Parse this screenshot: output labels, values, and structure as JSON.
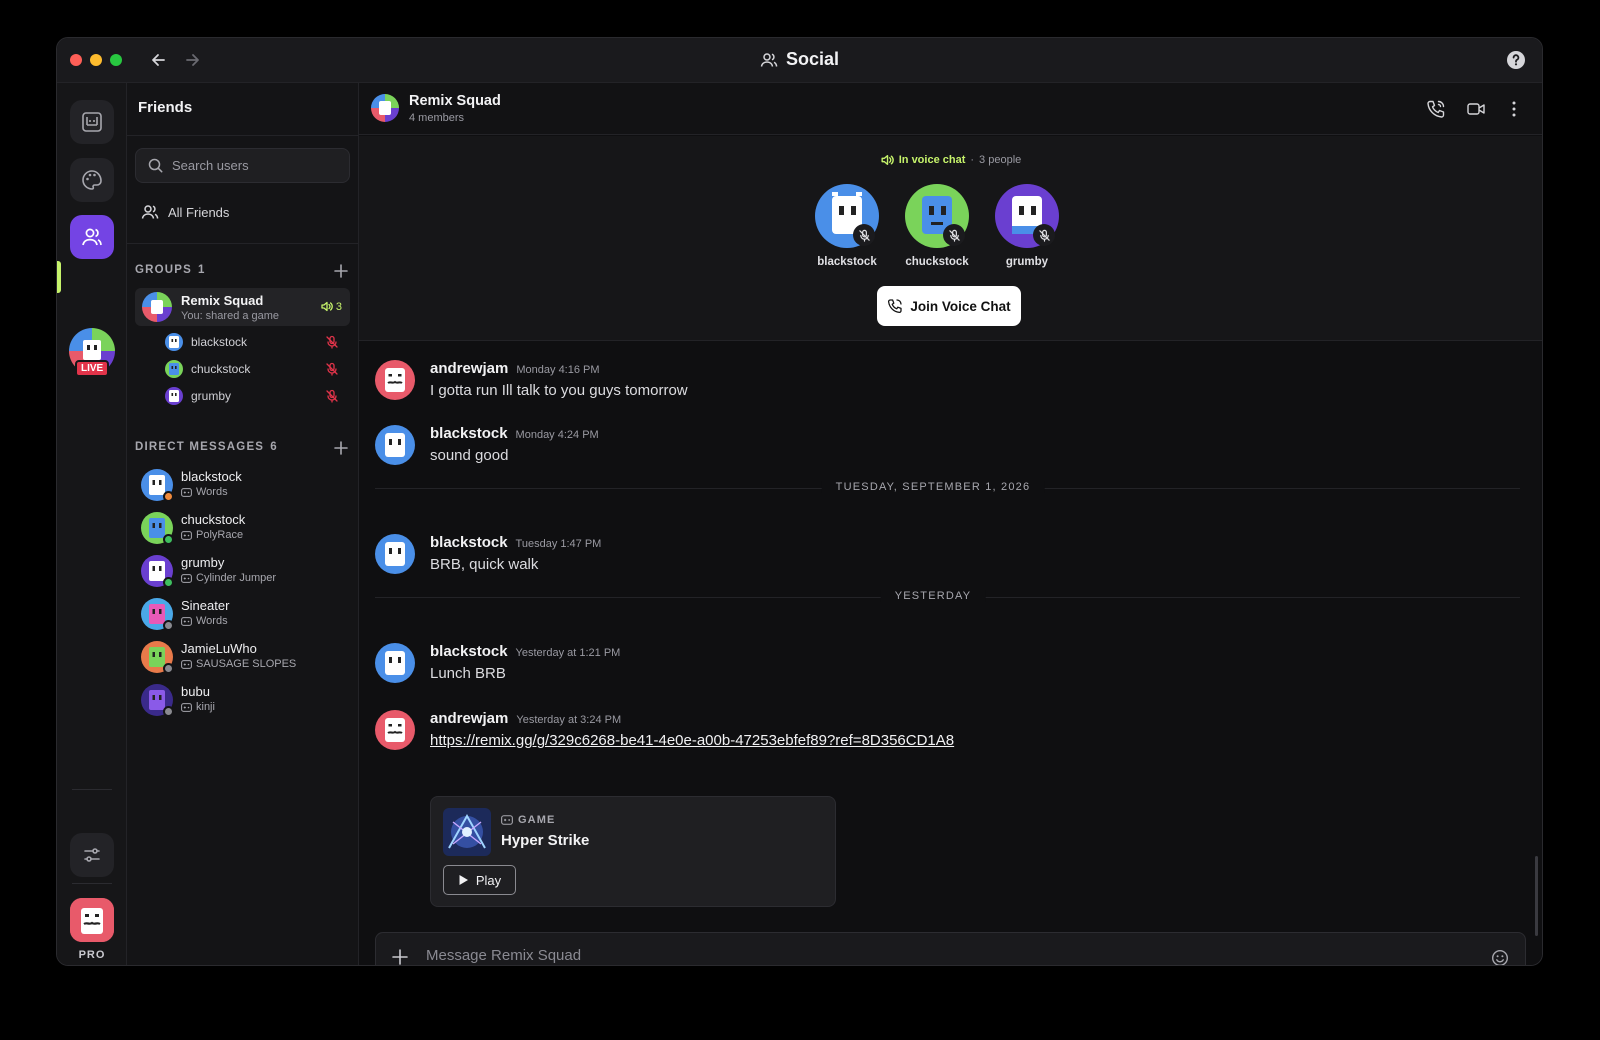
{
  "window": {
    "title": "Social"
  },
  "rail": {
    "live_label": "LIVE",
    "pro_label": "PRO"
  },
  "sidebar": {
    "title": "Friends",
    "search_placeholder": "Search users",
    "all_friends": "All Friends",
    "groups_label": "GROUPS",
    "groups_count": "1",
    "group": {
      "name": "Remix Squad",
      "subtitle": "You: shared a game",
      "voice_count": "3"
    },
    "group_members": [
      "blackstock",
      "chuckstock",
      "grumby"
    ],
    "dm_label": "DIRECT MESSAGES",
    "dm_count": "6",
    "dms": [
      {
        "name": "blackstock",
        "game": "Words",
        "status_color": "#f08a3c"
      },
      {
        "name": "chuckstock",
        "game": "PolyRace",
        "status_color": "#3fbf5f"
      },
      {
        "name": "grumby",
        "game": "Cylinder Jumper",
        "status_color": "#3fbf5f"
      },
      {
        "name": "Sineater",
        "game": "Words",
        "status_color": "#8a8a90"
      },
      {
        "name": "JamieLuWho",
        "game": "SAUSAGE SLOPES",
        "status_color": "#8a8a90"
      },
      {
        "name": "bubu",
        "game": "kinji",
        "status_color": "#8a8a90"
      }
    ]
  },
  "chat": {
    "name": "Remix Squad",
    "members_label": "4 members",
    "voice": {
      "status_label": "In voice chat",
      "people_label": "3 people",
      "users": [
        "blackstock",
        "chuckstock",
        "grumby"
      ],
      "join_label": "Join Voice Chat"
    },
    "messages": [
      {
        "author": "andrewjam",
        "time": "Monday 4:16 PM",
        "text": "I gotta run Ill talk to you guys tomorrow"
      },
      {
        "author": "blackstock",
        "time": "Monday 4:24 PM",
        "text": "sound good"
      },
      {
        "author": "blackstock",
        "time": "Tuesday 1:47 PM",
        "text": "BRB, quick walk"
      },
      {
        "author": "blackstock",
        "time": "Yesterday at 1:21 PM",
        "text": "Lunch BRB"
      },
      {
        "author": "andrewjam",
        "time": "Yesterday at 3:24 PM",
        "text": "https://remix.gg/g/329c6268-be41-4e0e-a00b-47253ebfef89?ref=8D356CD1A8"
      }
    ],
    "dividers": [
      "TUESDAY, SEPTEMBER 1, 2026",
      "YESTERDAY"
    ],
    "game_card": {
      "kind": "GAME",
      "title": "Hyper Strike",
      "play_label": "Play"
    },
    "composer_placeholder": "Message Remix Squad"
  },
  "colors": {
    "accent_lime": "#c6f36b",
    "accent_purple": "#7444e4",
    "mute_red": "#e2344a"
  }
}
